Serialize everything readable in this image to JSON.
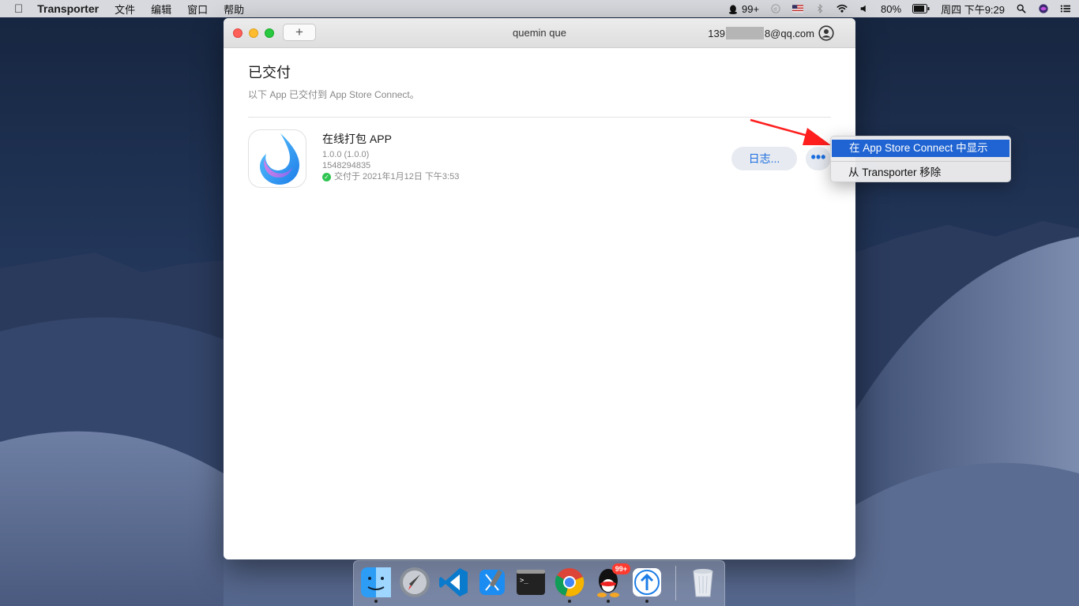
{
  "menubar": {
    "app_name": "Transporter",
    "menus": [
      "文件",
      "编辑",
      "窗口",
      "帮助"
    ],
    "qq_count": "99+",
    "battery": "80%",
    "clock": "周四 下午9:29"
  },
  "window": {
    "title": "quemin que",
    "account_prefix": "139",
    "account_suffix": "8@qq.com",
    "add_button_label": "+"
  },
  "content": {
    "title": "已交付",
    "subtitle": "以下 App 已交付到 App Store Connect。",
    "apps": [
      {
        "name": "在线打包 APP",
        "version": "1.0.0 (1.0.0)",
        "build_id": "1548294835",
        "delivered": "交付于 2021年1月12日 下午3:53",
        "log_button": "日志...",
        "more_button": "•••"
      }
    ]
  },
  "context_menu": {
    "items": [
      "在 App Store Connect 中显示",
      "从 Transporter 移除"
    ]
  },
  "dock": {
    "apps": [
      "finder",
      "launchpad",
      "vscode",
      "xcode",
      "terminal",
      "chrome",
      "qq",
      "transporter",
      "trash"
    ],
    "qq_badge": "99+"
  },
  "colors": {
    "accent": "#1c6fe0",
    "menu_highlight": "#1f64d2",
    "annotation": "#ff1e1e"
  }
}
